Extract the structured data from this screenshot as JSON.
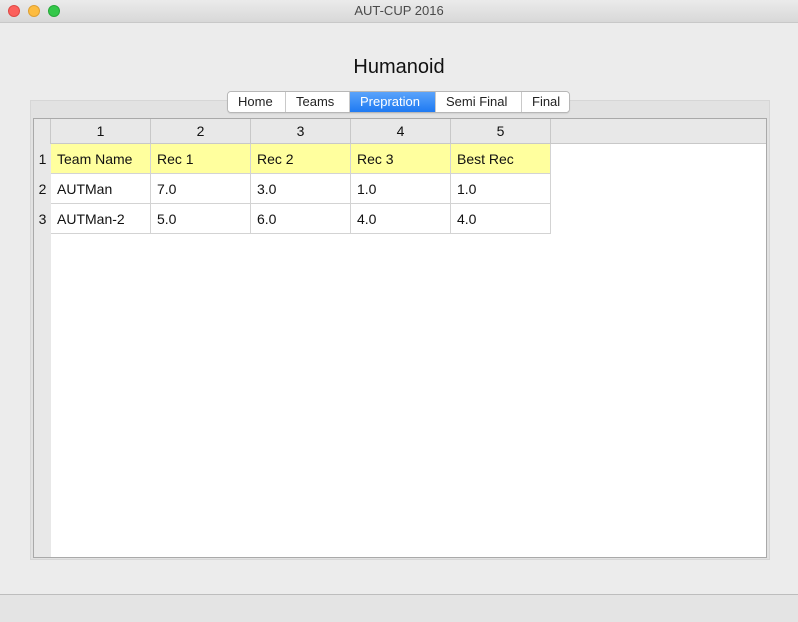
{
  "window": {
    "title": "AUT-CUP 2016"
  },
  "page": {
    "heading": "Humanoid"
  },
  "tabs": [
    {
      "label": "Home"
    },
    {
      "label": "Teams"
    },
    {
      "label": "Prepration",
      "selected": true
    },
    {
      "label": "Semi Final"
    },
    {
      "label": "Final"
    }
  ],
  "table": {
    "column_headers": [
      "1",
      "2",
      "3",
      "4",
      "5"
    ],
    "row_headers": [
      "1",
      "2",
      "3"
    ],
    "rows": [
      [
        "Team Name",
        "Rec 1",
        "Rec 2",
        "Rec 3",
        "Best Rec"
      ],
      [
        "AUTMan",
        "7.0",
        "3.0",
        "1.0",
        "1.0"
      ],
      [
        "AUTMan-2",
        "5.0",
        "6.0",
        "4.0",
        "4.0"
      ]
    ],
    "header_row_color": "#ffff9e"
  }
}
